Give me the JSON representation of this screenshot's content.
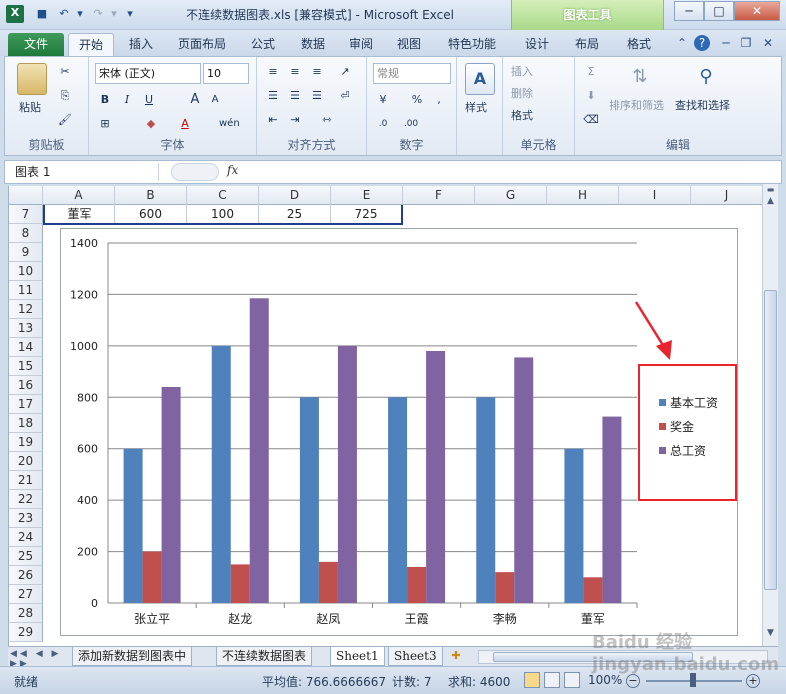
{
  "window": {
    "title": "不连续数据图表.xls  [兼容模式] - Microsoft Excel",
    "contextual_tab": "图表工具",
    "buttons": {
      "minimize": "─",
      "maximize": "□",
      "close": "✕"
    }
  },
  "ribbon_tabs": [
    "文件",
    "开始",
    "插入",
    "页面布局",
    "公式",
    "数据",
    "审阅",
    "视图",
    "特色功能",
    "设计",
    "布局",
    "格式"
  ],
  "ribbon": {
    "clipboard": {
      "paste": "粘贴",
      "label": "剪贴板"
    },
    "font": {
      "name": "宋体 (正文)",
      "size": "10",
      "bold": "B",
      "italic": "I",
      "underline": "U",
      "grow": "A",
      "shrink": "A",
      "label": "字体",
      "wen": "wén"
    },
    "alignment": {
      "label": "对齐方式"
    },
    "number": {
      "format": "常规",
      "percent": "%",
      "comma": ",",
      "label": "数字"
    },
    "styles": {
      "label": "样式"
    },
    "cells": {
      "insert": "插入",
      "delete": "删除",
      "format": "格式",
      "label": "单元格"
    },
    "editing": {
      "sort_filter": "排序和筛选",
      "find_select": "查找和选择",
      "sigma": "Σ",
      "label": "编辑"
    }
  },
  "formula_bar": {
    "name_box": "图表 1",
    "fx": "fx"
  },
  "columns": [
    "A",
    "B",
    "C",
    "D",
    "E",
    "F",
    "G",
    "H",
    "I",
    "J"
  ],
  "rows": [
    "7",
    "8",
    "9",
    "10",
    "11",
    "12",
    "13",
    "14",
    "15",
    "16",
    "17",
    "18",
    "19",
    "20",
    "21",
    "22",
    "23",
    "24",
    "25",
    "26",
    "27",
    "28",
    "29"
  ],
  "row7": [
    "董军",
    "600",
    "100",
    "25",
    "725"
  ],
  "chart_data": {
    "type": "bar",
    "categories": [
      "张立平",
      "赵龙",
      "赵凤",
      "王霞",
      "李畅",
      "董军"
    ],
    "series": [
      {
        "name": "基本工资",
        "color": "#4f81bd",
        "values": [
          600,
          1000,
          800,
          800,
          800,
          600
        ]
      },
      {
        "name": "奖金",
        "color": "#c0504d",
        "values": [
          200,
          150,
          160,
          140,
          120,
          100
        ]
      },
      {
        "name": "总工资",
        "color": "#8064a2",
        "values": [
          840,
          1185,
          1000,
          980,
          955,
          725
        ]
      }
    ],
    "yticks": [
      "0",
      "200",
      "400",
      "600",
      "800",
      "1000",
      "1200",
      "1400"
    ],
    "ylim": [
      0,
      1400
    ],
    "grid": true,
    "legend_position": "right",
    "title": "",
    "xlabel": "",
    "ylabel": ""
  },
  "sheet_tabs": [
    "添加新数据到图表中",
    "不连续数据图表",
    "Sheet1",
    "Sheet3"
  ],
  "status": {
    "ready": "就绪",
    "average": "平均值: 766.6666667",
    "count": "计数: 7",
    "sum": "求和: 4600",
    "zoom": "100%"
  },
  "watermark": "Baidu 经验 jingyan.baidu.com"
}
